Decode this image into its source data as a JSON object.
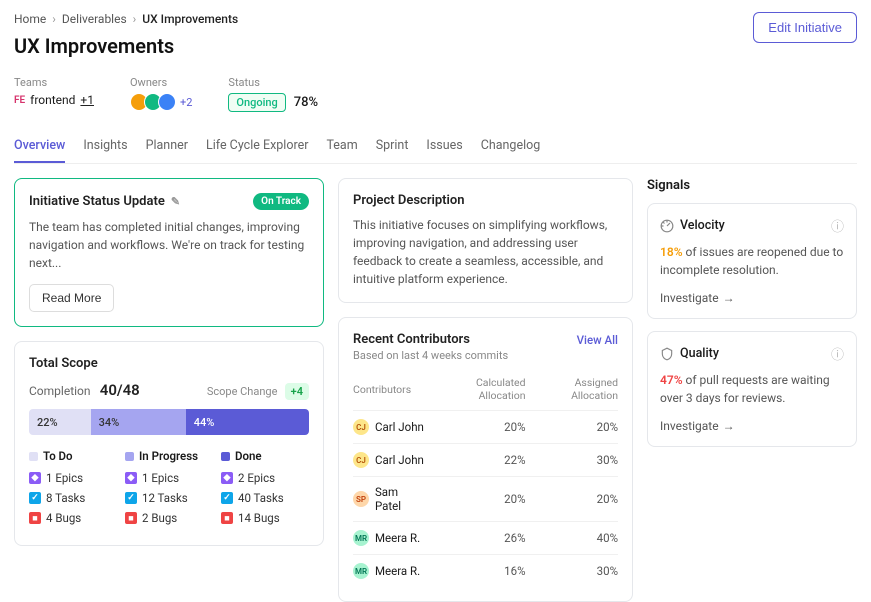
{
  "breadcrumb": {
    "home": "Home",
    "deliverables": "Deliverables",
    "current": "UX Improvements"
  },
  "page_title": "UX Improvements",
  "edit_button": "Edit Initiative",
  "meta": {
    "teams": {
      "label": "Teams",
      "badge": "FE",
      "name": "frontend",
      "more": "+1"
    },
    "owners": {
      "label": "Owners",
      "more": "+2"
    },
    "status": {
      "label": "Status",
      "tag": "Ongoing",
      "pct": "78%"
    }
  },
  "tabs": [
    "Overview",
    "Insights",
    "Planner",
    "Life Cycle Explorer",
    "Team",
    "Sprint",
    "Issues",
    "Changelog"
  ],
  "status_card": {
    "title": "Initiative Status Update",
    "badge": "On Track",
    "body": "The team has completed initial changes, improving navigation and workflows. We're on track for testing next...",
    "read_more": "Read More"
  },
  "desc_card": {
    "title": "Project Description",
    "body": "This initiative focuses on simplifying workflows, improving navigation, and addressing user feedback to create a seamless, accessible, and intuitive platform experience."
  },
  "scope": {
    "title": "Total Scope",
    "completion_label": "Completion",
    "completion_value": "40/48",
    "scope_change_label": "Scope Change",
    "scope_change_value": "+4",
    "segments": {
      "todo": "22%",
      "prog": "34%",
      "done": "44%"
    },
    "cols": {
      "todo": {
        "label": "To Do",
        "epics": "1 Epics",
        "tasks": "8 Tasks",
        "bugs": "4 Bugs"
      },
      "prog": {
        "label": "In Progress",
        "epics": "1 Epics",
        "tasks": "12 Tasks",
        "bugs": "2 Bugs"
      },
      "done": {
        "label": "Done",
        "epics": "2 Epics",
        "tasks": "40 Tasks",
        "bugs": "14 Bugs"
      }
    }
  },
  "contributors": {
    "title": "Recent Contributors",
    "subtitle": "Based on last 4 weeks commits",
    "view_all": "View All",
    "headers": {
      "name": "Contributors",
      "calc": "Calculated Allocation",
      "assigned": "Assigned Allocation"
    },
    "rows": [
      {
        "initials": "CJ",
        "cls": "cj",
        "name": "Carl John",
        "calc": "20%",
        "assigned": "20%"
      },
      {
        "initials": "CJ",
        "cls": "cj",
        "name": "Carl John",
        "calc": "22%",
        "assigned": "30%"
      },
      {
        "initials": "SP",
        "cls": "sp",
        "name": "Sam Patel",
        "calc": "20%",
        "assigned": "20%"
      },
      {
        "initials": "MR",
        "cls": "mr",
        "name": "Meera R.",
        "calc": "26%",
        "assigned": "40%"
      },
      {
        "initials": "MR",
        "cls": "mr",
        "name": "Meera R.",
        "calc": "16%",
        "assigned": "30%"
      }
    ]
  },
  "signals": {
    "title": "Signals",
    "velocity": {
      "name": "Velocity",
      "pct": "18%",
      "rest": " of issues are reopened due to incomplete resolution.",
      "action": "Investigate"
    },
    "quality": {
      "name": "Quality",
      "pct": "47%",
      "rest": " of pull requests are waiting over 3 days for reviews.",
      "action": "Investigate"
    }
  }
}
